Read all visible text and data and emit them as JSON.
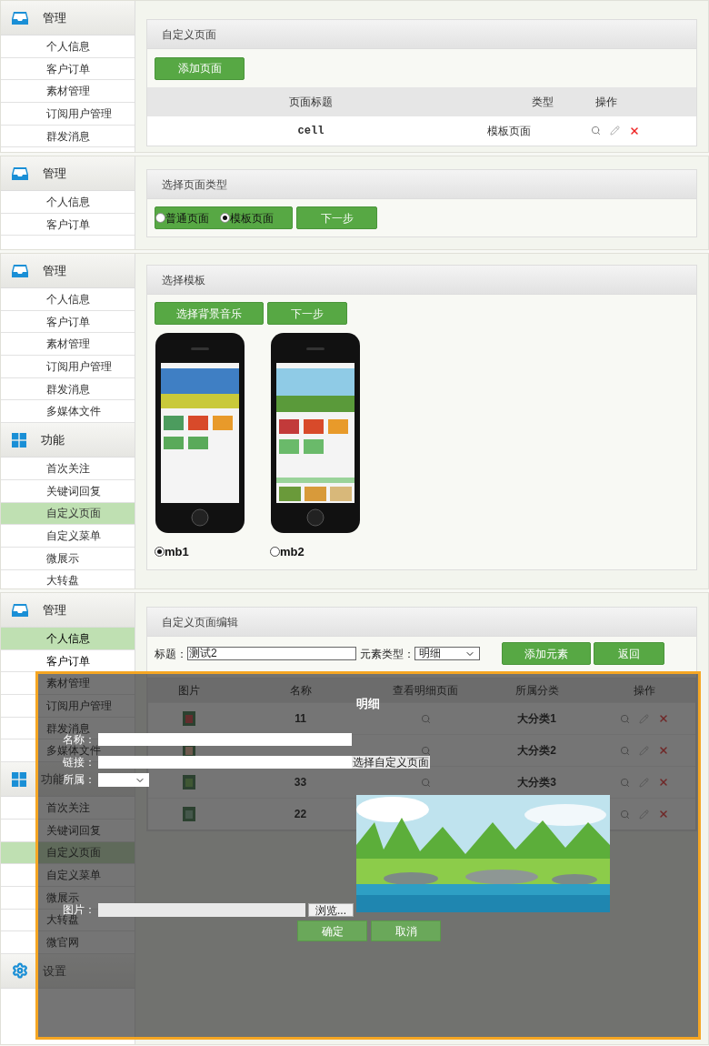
{
  "screens": [
    {
      "kind": "page_list",
      "sidebar": [
        {
          "kind": "inbox",
          "title": "管理",
          "items": [
            {
              "label": "个人信息",
              "selected": false
            },
            {
              "label": "客户订单",
              "selected": false
            },
            {
              "label": "素材管理",
              "selected": false
            },
            {
              "label": "订阅用户管理",
              "selected": false
            },
            {
              "label": "群发消息",
              "selected": false
            }
          ]
        }
      ],
      "panel": {
        "title": "自定义页面",
        "add_button": "添加页面",
        "columns": [
          "页面标题",
          "类型",
          "操作"
        ],
        "rows": [
          {
            "title": "cell",
            "type": "模板页面"
          }
        ]
      }
    },
    {
      "kind": "page_type",
      "sidebar": [
        {
          "kind": "inbox",
          "title": "管理",
          "items": [
            {
              "label": "个人信息",
              "selected": false
            },
            {
              "label": "客户订单",
              "selected": false
            }
          ]
        }
      ],
      "panel": {
        "title": "选择页面类型",
        "options": [
          {
            "label": "普通页面",
            "selected": false
          },
          {
            "label": "模板页面",
            "selected": true
          }
        ],
        "next_button": "下一步"
      }
    },
    {
      "kind": "template_select",
      "sidebar": [
        {
          "kind": "inbox",
          "title": "管理",
          "items": [
            {
              "label": "个人信息",
              "selected": false
            },
            {
              "label": "客户订单",
              "selected": false
            },
            {
              "label": "素材管理",
              "selected": false
            },
            {
              "label": "订阅用户管理",
              "selected": false
            },
            {
              "label": "群发消息",
              "selected": false
            },
            {
              "label": "多媒体文件",
              "selected": false
            }
          ]
        },
        {
          "kind": "windows",
          "title": "功能",
          "items": [
            {
              "label": "首次关注",
              "selected": false
            },
            {
              "label": "关键词回复",
              "selected": false
            },
            {
              "label": "自定义页面",
              "selected": true
            },
            {
              "label": "自定义菜单",
              "selected": false
            },
            {
              "label": "微展示",
              "selected": false
            },
            {
              "label": "大转盘",
              "selected": false
            }
          ]
        }
      ],
      "panel": {
        "title": "选择模板",
        "buttons": [
          "选择背景音乐",
          "下一步"
        ],
        "templates": [
          {
            "label": "mb1",
            "selected": true
          },
          {
            "label": "mb2",
            "selected": false
          }
        ]
      }
    },
    {
      "kind": "page_edit",
      "sidebar": [
        {
          "kind": "inbox",
          "title": "管理",
          "items": [
            {
              "label": "个人信息",
              "selected": true
            },
            {
              "label": "客户订单",
              "selected": false
            },
            {
              "label": "素材管理",
              "selected": false
            },
            {
              "label": "订阅用户管理",
              "selected": false
            },
            {
              "label": "群发消息",
              "selected": false
            },
            {
              "label": "多媒体文件",
              "selected": false
            }
          ]
        },
        {
          "kind": "windows",
          "title": "功能",
          "items": [
            {
              "label": "首次关注",
              "selected": false
            },
            {
              "label": "关键词回复",
              "selected": false
            },
            {
              "label": "自定义页面",
              "selected": true
            },
            {
              "label": "自定义菜单",
              "selected": false
            },
            {
              "label": "微展示",
              "selected": false
            },
            {
              "label": "大转盘",
              "selected": false
            },
            {
              "label": "微官网",
              "selected": false
            }
          ]
        },
        {
          "kind": "gear",
          "title": "设置"
        }
      ],
      "panel": {
        "title": "自定义页面编辑",
        "title_label": "标题：",
        "title_value": "测试2",
        "type_label": "元素类型：",
        "type_value": "明细",
        "buttons": [
          "添加元素",
          "返回"
        ],
        "columns": [
          "图片",
          "名称",
          "查看明细页面",
          "所属分类",
          "操作"
        ],
        "rows": [
          {
            "name": "11",
            "category": "大分类1"
          },
          {
            "category": "大分类2"
          },
          {
            "name": "33",
            "category": "大分类3"
          },
          {
            "name": "22"
          }
        ]
      },
      "dialog": {
        "title": "明细",
        "name_label": "名称：",
        "link_label": "链接：",
        "link_button": "选择自定义页面",
        "group_label": "所属：",
        "image_label": "图片：",
        "browse_button": "浏览...",
        "buttons": [
          "确定",
          "取消"
        ]
      }
    }
  ]
}
